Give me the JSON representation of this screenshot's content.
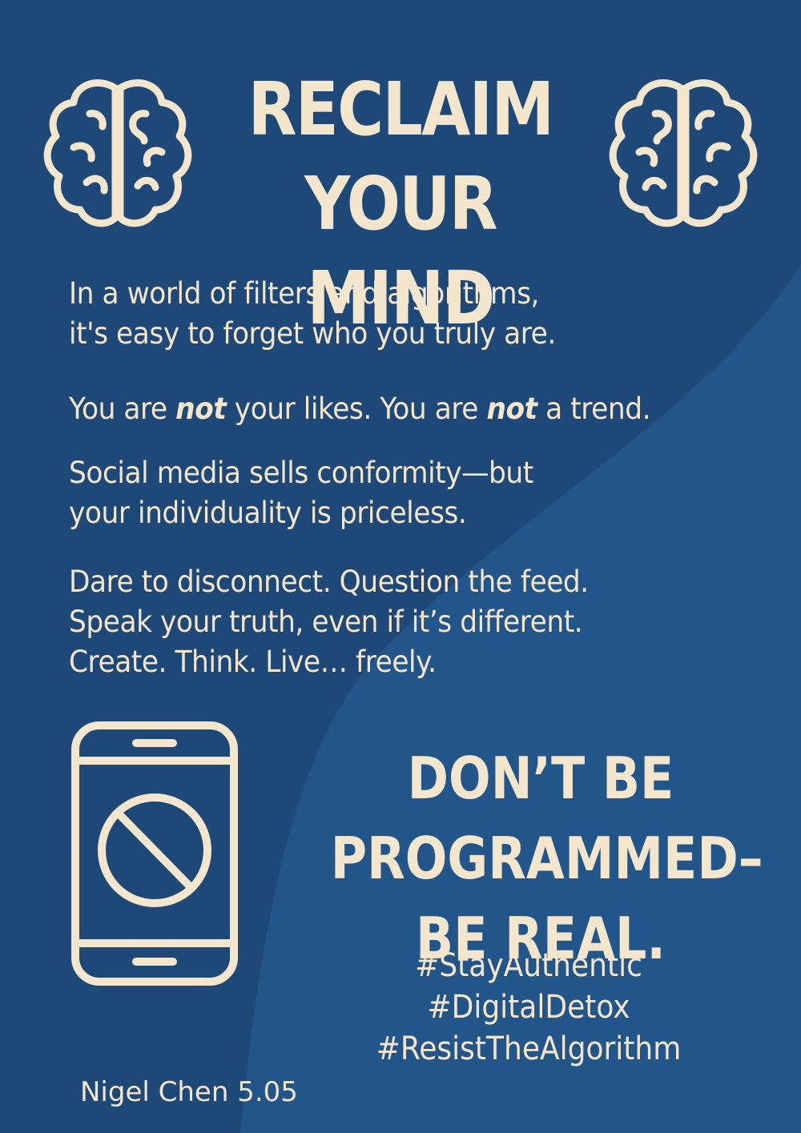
{
  "poster": {
    "title_line1": "RECLAIM",
    "title_line2": "YOUR MIND",
    "paragraph1": {
      "line1": "In a world of filters and algorithms,",
      "line2": "it's easy to forget who you truly are."
    },
    "paragraph2": {
      "part1": "You are ",
      "emph1": "not",
      "part2": " your likes. You are ",
      "emph2": "not",
      "part3": " a trend."
    },
    "paragraph3": {
      "line1": "Social media sells conformity—but",
      "line2": "your individuality is priceless."
    },
    "paragraph4": {
      "line1": "Dare to disconnect. Question the feed.",
      "line2": "Speak your truth, even if it’s different.",
      "line3": "Create. Think. Live… freely."
    },
    "slogan": {
      "line1": "DON’T BE",
      "line2": "PROGRAMMED–",
      "line3": "BE REAL."
    },
    "hashtags": [
      "#StayAuthentic",
      "#DigitalDetox",
      "#ResistTheAlgorithm"
    ],
    "author": "Nigel Chen 5.05"
  },
  "colors": {
    "background": "#1f4b7c",
    "background_light": "#245a8e",
    "text": "#f3e6cc"
  },
  "icons": [
    "brain-icon",
    "brain-icon",
    "phone-blocked-icon"
  ]
}
